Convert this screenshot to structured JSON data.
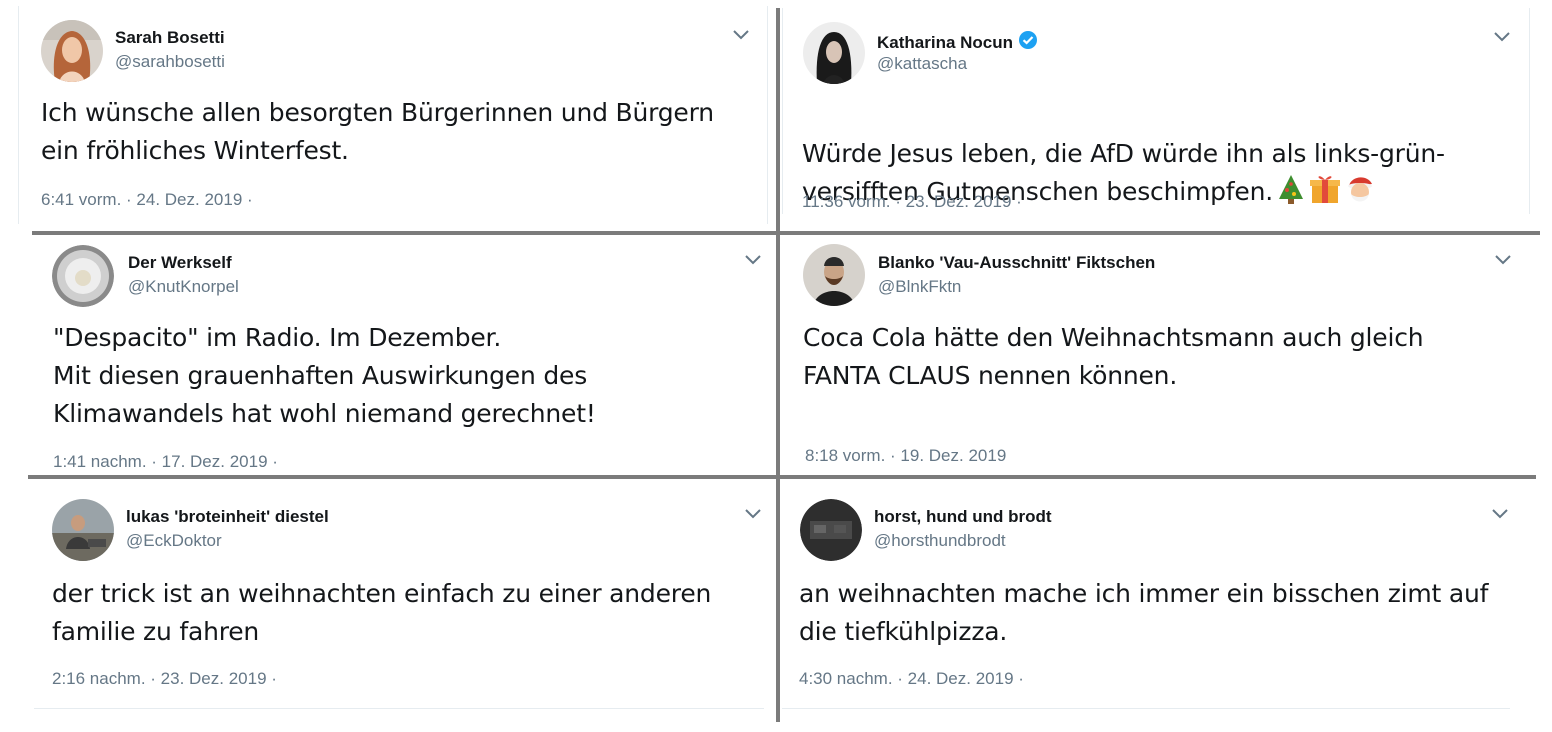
{
  "colors": {
    "divider": "#7b7b7b",
    "muted": "#657786",
    "verified": "#1da1f2",
    "text": "#14171a"
  },
  "tweets": [
    {
      "name": "Sarah Bosetti",
      "handle": "@sarahbosetti",
      "text": "Ich wünsche allen besorgten Bürgerinnen und Bürgern\nein fröhliches Winterfest.",
      "meta": "6:41 vorm. · 24. Dez. 2019 ·",
      "verified": false
    },
    {
      "name": "Katharina Nocun",
      "handle": "@kattascha",
      "text": "Würde Jesus leben, die AfD würde ihn als links-grün-\nversifften Gutmenschen beschimpfen.",
      "emoji": [
        "christmas-tree-icon",
        "gift-icon",
        "santa-icon"
      ],
      "meta": "11:36 vorm. · 23. Dez. 2019 ·",
      "verified": true
    },
    {
      "name": "Der Werkself",
      "handle": "@KnutKnorpel",
      "text": "\"Despacito\" im Radio. Im Dezember.\nMit diesen grauenhaften Auswirkungen des\nKlimawandels hat wohl niemand gerechnet!",
      "meta": "1:41 nachm. · 17. Dez. 2019 ·",
      "verified": false
    },
    {
      "name": "Blanko 'Vau-Ausschnitt' Fiktschen",
      "handle": "@BlnkFktn",
      "text": "Coca Cola hätte den Weihnachtsmann auch gleich\nFANTA CLAUS nennen können.",
      "meta": "8:18 vorm. · 19. Dez. 2019",
      "verified": false
    },
    {
      "name": "lukas 'broteinheit' diestel",
      "handle": "@EckDoktor",
      "text": "der trick ist an weihnachten einfach zu einer anderen\nfamilie zu fahren",
      "meta": "2:16 nachm. · 23. Dez. 2019 ·",
      "verified": false
    },
    {
      "name": "horst, hund und brodt",
      "handle": "@horsthundbrodt",
      "text": "an weihnachten mache ich immer ein bisschen zimt auf\ndie tiefkühlpizza.",
      "meta": "4:30 nachm. · 24. Dez. 2019 ·",
      "verified": false
    }
  ]
}
